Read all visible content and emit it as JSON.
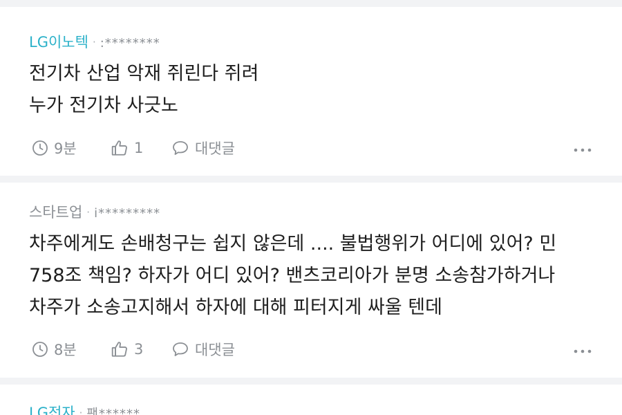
{
  "comments": [
    {
      "author": "LG이노텍",
      "masked_id": ":********",
      "lines": [
        "전기차 산업 악재 쥐린다 쥐려",
        "누가 전기차 사긋노"
      ],
      "time": "9분",
      "likes": "1",
      "reply_label": "대댓글"
    },
    {
      "author": "스타트업",
      "masked_id": "i*********",
      "lines": [
        "차주에게도 손배청구는 쉽지 않은데 .... 불법행위가 어디에 있어? 민",
        "758조 책임? 하자가 어디 있어? 밴츠코리아가 분명 소송참가하거나",
        "차주가 소송고지해서 하자에 대해 피터지게 싸울 텐데"
      ],
      "time": "8분",
      "likes": "3",
      "reply_label": "대댓글"
    },
    {
      "author": "LG전자",
      "masked_id": "팬******"
    }
  ],
  "colors": {
    "brand_author": "#2bb1c9",
    "muted": "#8b8f94",
    "text": "#1e1e1e",
    "separator": "#f2f3f5"
  },
  "icons": [
    "clock-icon",
    "thumbs-up-icon",
    "speech-bubble-icon",
    "more-dots-icon"
  ]
}
